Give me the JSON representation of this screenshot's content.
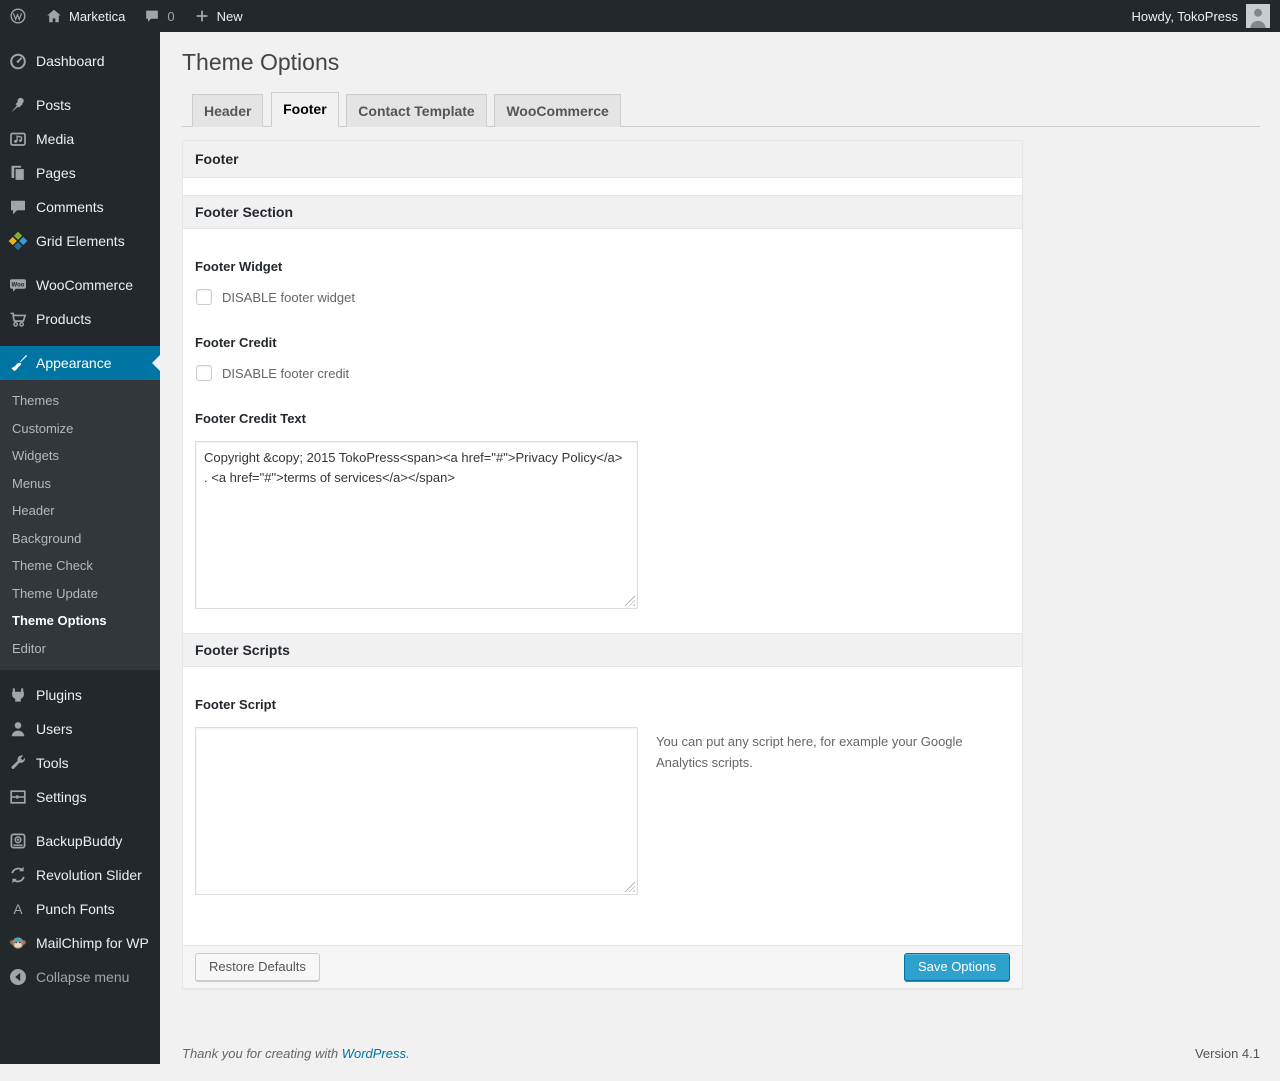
{
  "admin_bar": {
    "site_name": "Marketica",
    "comment_count": "0",
    "new_label": "New",
    "howdy": "Howdy, TokoPress"
  },
  "sidebar": {
    "items": [
      {
        "label": "Dashboard",
        "icon": "dashboard-icon"
      },
      {
        "label": "Posts",
        "icon": "pushpin-icon"
      },
      {
        "label": "Media",
        "icon": "media-icon"
      },
      {
        "label": "Pages",
        "icon": "pages-icon"
      },
      {
        "label": "Comments",
        "icon": "comment-bubble-icon"
      },
      {
        "label": "Grid Elements",
        "icon": "grid-elements-icon"
      },
      {
        "label": "WooCommerce",
        "icon": "woocommerce-badge-icon"
      },
      {
        "label": "Products",
        "icon": "cart-icon"
      },
      {
        "label": "Appearance",
        "icon": "paintbrush-icon",
        "active": true
      },
      {
        "label": "Plugins",
        "icon": "plug-icon"
      },
      {
        "label": "Users",
        "icon": "person-icon"
      },
      {
        "label": "Tools",
        "icon": "wrench-icon"
      },
      {
        "label": "Settings",
        "icon": "sliders-icon"
      },
      {
        "label": "BackupBuddy",
        "icon": "backup-icon"
      },
      {
        "label": "Revolution Slider",
        "icon": "refresh-arrows-icon"
      },
      {
        "label": "Punch Fonts",
        "icon": "letter-a-icon"
      },
      {
        "label": "MailChimp for WP",
        "icon": "monkey-icon"
      },
      {
        "label": "Collapse menu",
        "icon": "collapse-arrow-icon"
      }
    ],
    "appearance_submenu": {
      "items": [
        "Themes",
        "Customize",
        "Widgets",
        "Menus",
        "Header",
        "Background",
        "Theme Check",
        "Theme Update",
        "Theme Options",
        "Editor"
      ],
      "current": "Theme Options"
    }
  },
  "page": {
    "title": "Theme Options",
    "tabs": [
      {
        "label": "Header",
        "active": false
      },
      {
        "label": "Footer",
        "active": true
      },
      {
        "label": "Contact Template",
        "active": false
      },
      {
        "label": "WooCommerce",
        "active": false
      }
    ],
    "panel": {
      "header": "Footer",
      "sections": [
        {
          "title": "Footer Section",
          "fields": [
            {
              "label": "Footer Widget",
              "checkbox_label": "DISABLE footer widget",
              "checked": false
            },
            {
              "label": "Footer Credit",
              "checkbox_label": "DISABLE footer credit",
              "checked": false
            },
            {
              "label": "Footer Credit Text",
              "value": "Copyright &copy; 2015 TokoPress<span><a href=\"#\">Privacy Policy</a> . <a href=\"#\">terms of services</a></span>"
            }
          ]
        },
        {
          "title": "Footer Scripts",
          "fields": [
            {
              "label": "Footer Script",
              "value": "",
              "help": "You can put any script here, for example your Google Analytics scripts."
            }
          ]
        }
      ],
      "actions": {
        "restore": "Restore Defaults",
        "save": "Save Options"
      }
    },
    "footer": {
      "thanks_prefix": "Thank you for creating with ",
      "wordpress_link": "WordPress",
      "thanks_suffix": ".",
      "version": "Version 4.1"
    }
  },
  "colors": {
    "admin_bar_bg": "#23282d",
    "menu_bg": "#23282d",
    "submenu_bg": "#32373c",
    "menu_highlight": "#0074a2",
    "link": "#0074a2",
    "primary_button_bg": "#2ea2cc",
    "primary_button_border": "#0074a2",
    "page_bg": "#f1f1f1"
  }
}
